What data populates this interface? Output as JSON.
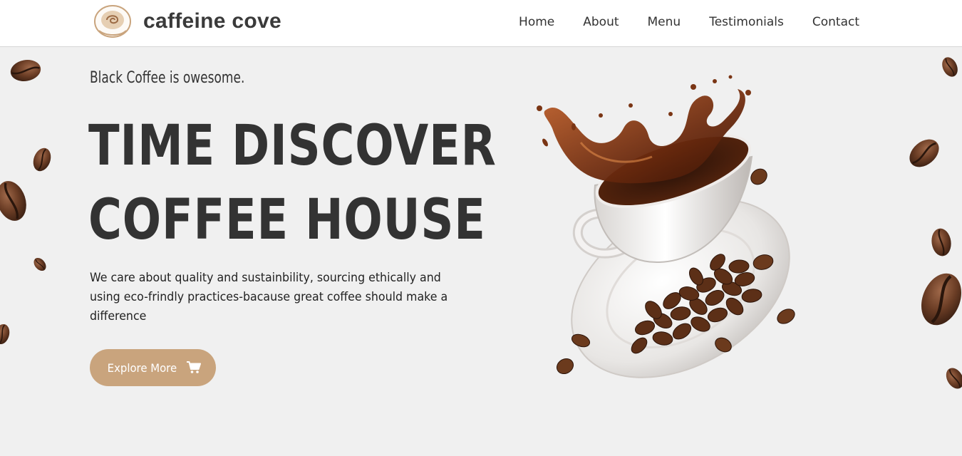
{
  "brand": {
    "name": "caffeine cove",
    "logo_icon": "coffee-cup-logo-icon"
  },
  "nav": {
    "items": [
      {
        "label": "Home"
      },
      {
        "label": "About"
      },
      {
        "label": "Menu"
      },
      {
        "label": "Testimonials"
      },
      {
        "label": "Contact"
      }
    ]
  },
  "hero": {
    "tagline": "Black Coffee is owesome.",
    "headline_line1": "TIME DISCOVER",
    "headline_line2": "COFFEE HOUSE",
    "description": "We care about quality and sustainbility, sourcing ethically and using eco-frindly practices-bacause great coffee should make a difference",
    "cta": {
      "label": "Explore More",
      "icon": "cart-icon"
    }
  },
  "colors": {
    "background": "#f0f0f0",
    "header": "#ffffff",
    "accent": "#c9a47d",
    "text": "#333333"
  }
}
